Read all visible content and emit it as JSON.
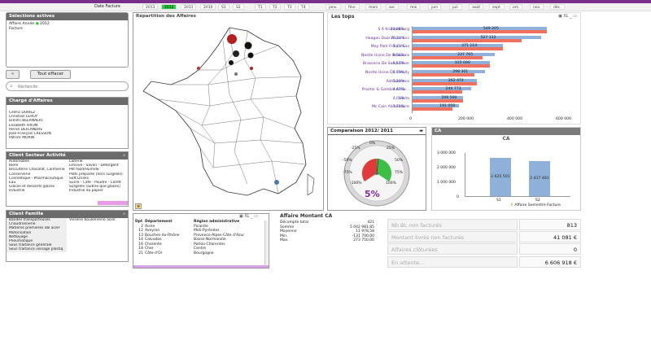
{
  "datebar": {
    "label": "Date Facture",
    "years": [
      "2013",
      "2012",
      "2011",
      "2010"
    ],
    "semesters": [
      "S1",
      "S2"
    ],
    "quarters": [
      "T1",
      "T2",
      "T3",
      "T4"
    ],
    "months": [
      "janv.",
      "févr.",
      "mars",
      "avr.",
      "mai",
      "juin",
      "juil.",
      "août",
      "sept.",
      "oct.",
      "nov.",
      "déc."
    ]
  },
  "selections": {
    "title": "Sélections actives",
    "rows": [
      {
        "field": "Affaire Année",
        "value": "2012"
      },
      {
        "field": "Facture",
        "value": ""
      }
    ]
  },
  "buttons": {
    "back": "«",
    "clear_all": "Tout effacer"
  },
  "search": {
    "placeholder": "Recherche"
  },
  "charge": {
    "title": "Chargé d'Affaires",
    "items": [
      "Cédric DURIEZ",
      "Christian LEROY",
      "Dimitri BEERNAERT",
      "Elisabeth FRION",
      "Hervé DEFLANDRE",
      "Jean-François CRESSON",
      "Patrick MORIN"
    ]
  },
  "secteur": {
    "title": "Client Secteur Activité",
    "left": [
      "Automobile",
      "Bière",
      "Biscuiterie Chocolat, Confiserie",
      "Conserverie",
      "Cosmétique - Pharmaceutique",
      "Eau",
      "Glaces et desserts glacés",
      "Industrie"
    ],
    "right": [
      "Laiterie",
      "Lessive - Savon - Détergent",
      "Pet food/Humide",
      "Plats préparés (hors surgelés)",
      "Soft Drinks",
      "Sucre - Café - Poudre - Confit",
      "Surgelés (autres que glaces)",
      "Industrie du papier"
    ]
  },
  "famille": {
    "title": "Client Famille",
    "left": [
      "Bandes transporteuses",
      "Chaudronnerie",
      "Matières premières obl acier",
      "Motorisation",
      "Nettoyage",
      "Pneumatique",
      "Sous traitance générale",
      "Sous traitance usinage plastiq"
    ],
    "right": [
      "Visserie boulonnerie acier"
    ]
  },
  "map": {
    "title": "Répartition des Affaires"
  },
  "dept_table": {
    "columns": [
      "Dpt",
      "Département",
      "Région administrative"
    ],
    "rows": [
      [
        "2",
        "Aisne",
        "Picardie"
      ],
      [
        "12",
        "Aveyron",
        "Midi-Pyrénées"
      ],
      [
        "13",
        "Bouches-du-Rhône",
        "Provence-Alpes-Côte d'Azur"
      ],
      [
        "14",
        "Calvados",
        "Basse-Normandie"
      ],
      [
        "16",
        "Charente",
        "Poitou-Charentes"
      ],
      [
        "18",
        "Cher",
        "Centre"
      ],
      [
        "21",
        "Côte-d'Or",
        "Bourgogne"
      ]
    ]
  },
  "affaire_ca": {
    "title": "Affaire Montant CA",
    "rows": [
      [
        "Décompte total",
        "421"
      ],
      [
        "Somme",
        "5 042 981,85"
      ],
      [
        "Moyenne",
        "11 978,58"
      ],
      [
        "Min.",
        "-131 700,00"
      ],
      [
        "Max.",
        "273 750,00"
      ]
    ]
  },
  "tops": {
    "title": "Les tops",
    "axis_ticks": [
      "0",
      "200 000",
      "400 000",
      "600 000"
    ],
    "rows": [
      {
        "label": "S A Kronenbourg",
        "pct": "10,84%",
        "value": "549 205"
      },
      {
        "label": "Haagen Dazs Arras Snc",
        "pct": "10,23%",
        "value": "527 112"
      },
      {
        "label": "Moy Park France Sas",
        "pct": "7,21%",
        "value": "371 114"
      },
      {
        "label": "Nestle Usine De Beauvais",
        "pct": "6,56%",
        "value": "337 765"
      },
      {
        "label": "Brasserie De Saint-Omer",
        "pct": "6,12%",
        "value": "315 000"
      },
      {
        "label": "Nestle Usine De Creully",
        "pct": "5,79%",
        "value": "298 301"
      },
      {
        "label": "Astrazeneca",
        "pct": "5,10%",
        "value": "262 474"
      },
      {
        "label": "Procter & Gamble Amie...",
        "pct": "4,67%",
        "value": "240 773"
      },
      {
        "label": "Herta",
        "pct": "4,01%",
        "value": "206 500"
      },
      {
        "label": "Mc Cain Alimentaire",
        "pct": "3,71%",
        "value": "191 050"
      }
    ]
  },
  "comparaison": {
    "title": "Comparaison 2012/ 2011",
    "value": "5%",
    "scale": [
      "-100%",
      "-75%",
      "-50%",
      "-25%",
      "0%",
      "25%",
      "50%",
      "75%",
      "100%"
    ]
  },
  "ca_chart": {
    "panel_title": "CA",
    "title": "CA",
    "yticks": [
      "3 000 000",
      "2 000 000",
      "1 000 000",
      "0"
    ],
    "legend": "Affaire Semestre Facture",
    "bar_color": "#8fb0d8"
  },
  "chart_data": {
    "type": "bar",
    "title": "CA",
    "categories": [
      "S1",
      "S2"
    ],
    "values": [
      2625501,
      2417481
    ],
    "ylim": [
      0,
      3000000
    ],
    "xlabel": "",
    "ylabel": ""
  },
  "kpis": [
    {
      "label": "Nb BL non facturés",
      "value": "813"
    },
    {
      "label": "Montant livrés non facturés",
      "value": "41 081 €"
    },
    {
      "label": "Affaires clôturées",
      "value": "0"
    },
    {
      "label": "En attente...",
      "value": "6 606 918 €"
    }
  ],
  "colors": {
    "accent": "#7b2f8a",
    "selected": "#2ecc40",
    "bar_red": "#f07060",
    "bar_blue": "#8fb0d8"
  }
}
